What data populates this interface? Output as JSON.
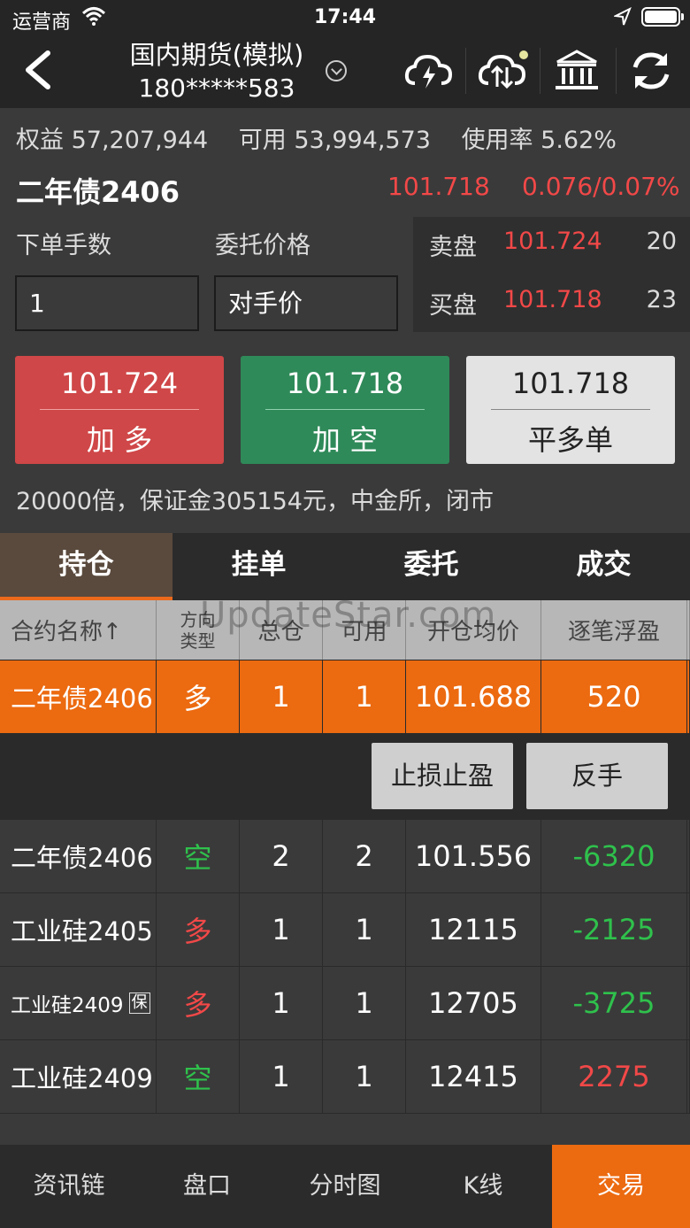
{
  "status": {
    "carrier": "运营商",
    "time": "17:44"
  },
  "header": {
    "title": "国内期货(模拟)",
    "account": "180*****583"
  },
  "summary": {
    "equity_label": "权益",
    "equity": "57,207,944",
    "avail_label": "可用",
    "avail": "53,994,573",
    "usage_label": "使用率",
    "usage": "5.62%"
  },
  "instrument": {
    "name": "二年债2406",
    "last": "101.718",
    "change": "0.076/0.07%"
  },
  "order": {
    "qty_label": "下单手数",
    "qty": "1",
    "price_label": "委托价格",
    "price": "对手价"
  },
  "book": {
    "ask_label": "卖盘",
    "ask_price": "101.724",
    "ask_vol": "20",
    "bid_label": "买盘",
    "bid_price": "101.718",
    "bid_vol": "23"
  },
  "trade_buttons": {
    "buy_price": "101.724",
    "buy_label": "加 多",
    "sell_price": "101.718",
    "sell_label": "加 空",
    "close_price": "101.718",
    "close_label": "平多单"
  },
  "info": "20000倍，保证金305154元，中金所，闭市",
  "tabs": [
    "持仓",
    "挂单",
    "委托",
    "成交"
  ],
  "table": {
    "headers": {
      "name": "合约名称↑",
      "dir_1": "方向",
      "dir_2": "类型",
      "total": "总仓",
      "avail": "可用",
      "avg": "开仓均价",
      "pnl": "逐笔浮盈"
    },
    "rows": [
      {
        "name": "二年债2406",
        "dir": "多",
        "total": "1",
        "avail": "1",
        "avg": "101.688",
        "pnl": "520"
      },
      {
        "name": "二年债2406",
        "dir": "空",
        "total": "2",
        "avail": "2",
        "avg": "101.556",
        "pnl": "-6320"
      },
      {
        "name": "工业硅2405",
        "dir": "多",
        "total": "1",
        "avail": "1",
        "avg": "12115",
        "pnl": "-2125"
      },
      {
        "name": "工业硅2409",
        "tag": "保",
        "dir": "多",
        "total": "1",
        "avail": "1",
        "avg": "12705",
        "pnl": "-3725"
      },
      {
        "name": "工业硅2409",
        "dir": "空",
        "total": "1",
        "avail": "1",
        "avg": "12415",
        "pnl": "2275"
      }
    ],
    "actions": {
      "stop": "止损止盈",
      "reverse": "反手"
    }
  },
  "watermark": "UpdateStar.com",
  "bottom_nav": [
    "资讯链",
    "盘口",
    "分时图",
    "K线",
    "交易"
  ],
  "colors": {
    "accent": "#ec6a10",
    "up": "#f24848",
    "down": "#2fc14c",
    "buy": "#cf4748",
    "sell": "#2f8a59"
  }
}
